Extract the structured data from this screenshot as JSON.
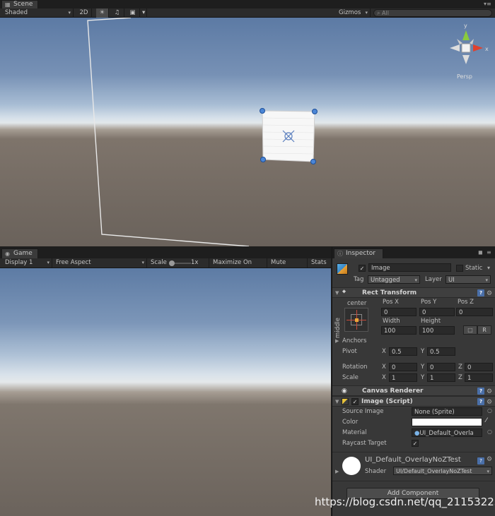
{
  "scene": {
    "tab_label": "Scene",
    "shading_mode": "Shaded",
    "mode_2d": "2D",
    "gizmos_label": "Gizmos",
    "search_placeholder": "All",
    "projection_label": "Persp",
    "axis_y": "y",
    "axis_x": "x"
  },
  "game": {
    "tab_label": "Game",
    "display": "Display 1",
    "aspect": "Free Aspect",
    "scale_label": "Scale",
    "scale_value": "1x",
    "maximize_on_play": "Maximize On Play",
    "mute_audio": "Mute Audio",
    "stats": "Stats"
  },
  "inspector": {
    "tab_label": "Inspector",
    "object_name": "Image",
    "object_active": true,
    "static_label": "Static",
    "tag_label": "Tag",
    "tag_value": "Untagged",
    "layer_label": "Layer",
    "layer_value": "UI",
    "rect_transform": {
      "title": "Rect Transform",
      "anchor_h": "center",
      "anchor_v": "middle",
      "pos_x_label": "Pos X",
      "pos_y_label": "Pos Y",
      "pos_z_label": "Pos Z",
      "pos_x": "0",
      "pos_y": "0",
      "pos_z": "0",
      "width_label": "Width",
      "height_label": "Height",
      "width": "100",
      "height": "100",
      "raw_edit": "R",
      "anchors_label": "Anchors",
      "pivot_label": "Pivot",
      "pivot_x": "0.5",
      "pivot_y": "0.5",
      "rotation_label": "Rotation",
      "rotation_x": "0",
      "rotation_y": "0",
      "rotation_z": "0",
      "scale_label": "Scale",
      "scale_x": "1",
      "scale_y": "1",
      "scale_z": "1",
      "x": "X",
      "y": "Y",
      "z": "Z"
    },
    "canvas_renderer": {
      "title": "Canvas Renderer"
    },
    "image_script": {
      "title": "Image (Script)",
      "enabled": true,
      "source_image_label": "Source Image",
      "source_image_value": "None (Sprite)",
      "color_label": "Color",
      "color_value": "#ffffff",
      "material_label": "Material",
      "material_value": "UI_Default_Overla",
      "raycast_label": "Raycast Target",
      "raycast_value": true
    },
    "material_section": {
      "name": "UI_Default_OverlayNoZTest",
      "shader_label": "Shader",
      "shader_value": "UI/Default_OverlayNoZTest"
    },
    "add_component": "Add Component"
  },
  "watermark": "https://blog.csdn.net/qq_21153225"
}
